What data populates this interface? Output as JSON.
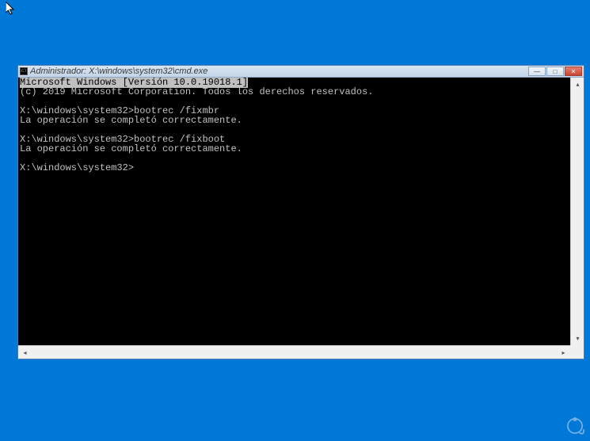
{
  "window": {
    "title": "Administrador: X:\\windows\\system32\\cmd.exe",
    "icon_label": "cmd"
  },
  "terminal": {
    "line_header": "Microsoft Windows [Versión 10.0.19018.1]",
    "line_copyright": "(c) 2019 Microsoft Corporation. Todos los derechos reservados.",
    "blank1": "",
    "prompt1": "X:\\windows\\system32>bootrec /fixmbr",
    "result1": "La operación se completó correctamente.",
    "blank2": "",
    "prompt2": "X:\\windows\\system32>bootrec /fixboot",
    "result2": "La operación se completó correctamente.",
    "blank3": "",
    "prompt3": "X:\\windows\\system32>"
  },
  "controls": {
    "minimize": "—",
    "maximize": "□",
    "close": "✕"
  }
}
